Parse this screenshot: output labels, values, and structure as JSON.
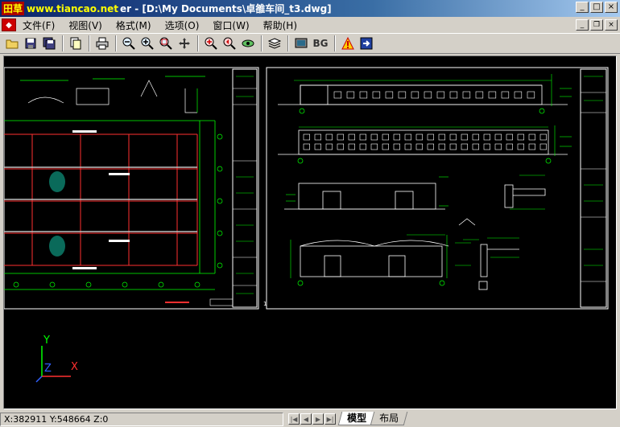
{
  "window": {
    "brand_logo": "田草",
    "brand_url": "www.tiancao.net",
    "title": "er - [D:\\My Documents\\卓雒车间_t3.dwg]",
    "controls": [
      "_",
      "□",
      "×"
    ]
  },
  "menu": {
    "items": [
      "文件(F)",
      "视图(V)",
      "格式(M)",
      "选项(O)",
      "窗口(W)",
      "帮助(H)"
    ],
    "mdi_controls": [
      "_",
      "❐",
      "×"
    ]
  },
  "toolbar": {
    "bg_label": "BG",
    "icons": [
      "open-icon",
      "save-icon",
      "save-all-icon",
      "copy-icon",
      "print-icon",
      "zoom-out-icon",
      "zoom-in-icon",
      "zoom-window-icon",
      "pan-icon",
      "zoom-extents-icon",
      "zoom-previous-icon",
      "view-icon",
      "layers-icon",
      "display-icon",
      "bg-icon",
      "warning-icon",
      "export-icon"
    ]
  },
  "drawing": {
    "ucs_y": "Y",
    "ucs_x": "X",
    "ucs_z": "Z",
    "page_number": "1",
    "colors": {
      "background": "#000000",
      "white": "#ffffff",
      "green": "#00ff00",
      "red": "#ff3030",
      "cyan": "#00c8c8",
      "yellow": "#ffff00"
    }
  },
  "status": {
    "coords": "X:382911 Y:548664 Z:0",
    "nav": [
      "|◀",
      "◀",
      "▶",
      "▶|"
    ],
    "tabs": [
      "模型",
      "布局"
    ],
    "active_tab": "模型"
  }
}
